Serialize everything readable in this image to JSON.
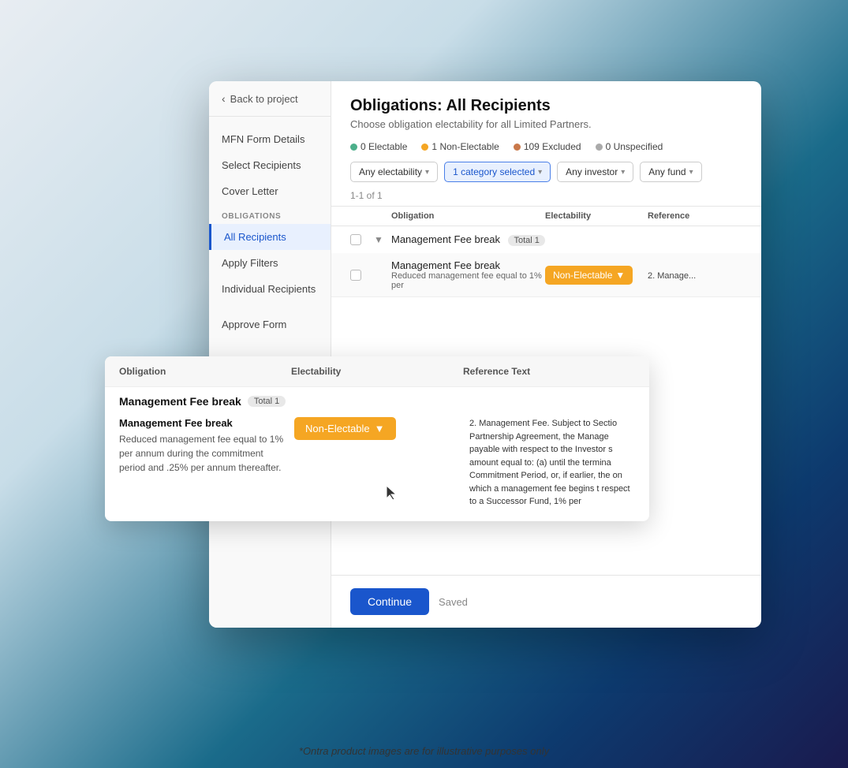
{
  "background": {
    "gradient": "linear-gradient"
  },
  "back_link": {
    "label": "Back to project"
  },
  "sidebar": {
    "items": [
      {
        "id": "mfn-form-details",
        "label": "MFN Form Details",
        "active": false
      },
      {
        "id": "select-recipients",
        "label": "Select Recipients",
        "active": false
      },
      {
        "id": "cover-letter",
        "label": "Cover Letter",
        "active": false
      }
    ],
    "section_label": "OBLIGATIONS",
    "obligation_items": [
      {
        "id": "all-recipients",
        "label": "All Recipients",
        "active": true
      },
      {
        "id": "apply-filters",
        "label": "Apply Filters",
        "active": false
      },
      {
        "id": "individual-recipients",
        "label": "Individual Recipients",
        "active": false
      }
    ],
    "approve_form": "Approve Form"
  },
  "main": {
    "title": "Obligations: All Recipients",
    "subtitle": "Choose obligation electability for all Limited Partners.",
    "status": [
      {
        "id": "electable",
        "color": "#4caf8a",
        "count": "0",
        "label": "Electable"
      },
      {
        "id": "non-electable",
        "color": "#f5a623",
        "count": "1",
        "label": "Non-Electable"
      },
      {
        "id": "excluded",
        "color": "#c9784a",
        "count": "109",
        "label": "Excluded"
      },
      {
        "id": "unspecified",
        "color": "#aaa",
        "count": "0",
        "label": "Unspecified"
      }
    ],
    "filters": [
      {
        "id": "electability",
        "label": "Any electability",
        "active": false
      },
      {
        "id": "category",
        "label": "1 category selected",
        "active": true
      },
      {
        "id": "investor",
        "label": "Any investor",
        "active": false
      },
      {
        "id": "fund",
        "label": "Any fund",
        "active": false
      }
    ],
    "results_info": "1-1 of 1",
    "table": {
      "headers": [
        "",
        "",
        "Obligation",
        "Electability",
        "Reference"
      ],
      "groups": [
        {
          "name": "Management Fee break",
          "total": "Total 1",
          "rows": [
            {
              "name": "Management Fee break",
              "desc": "Reduced management fee equal to 1% per",
              "electability": "Non-Electable",
              "ref_preview": "2. Manage..."
            }
          ]
        }
      ]
    }
  },
  "footer": {
    "continue_label": "Continue",
    "saved_label": "Saved"
  },
  "popup": {
    "headers": [
      "Obligation",
      "Electability",
      "Reference Text"
    ],
    "group_name": "Management Fee break",
    "group_total": "Total 1",
    "item": {
      "name": "Management Fee break",
      "description": "Reduced management fee equal to 1% per annum during the commitment period and .25% per annum thereafter.",
      "electability": "Non-Electable",
      "reference_text": "2. Management Fee. Subject to Sectio Partnership Agreement, the Manage payable with respect to the Investor s amount equal to: (a) until the termina Commitment Period, or, if earlier, the on which a management fee begins t respect to a Successor Fund, 1% per"
    }
  },
  "footnote": "*Ontra product images are for illustrative purposes only"
}
